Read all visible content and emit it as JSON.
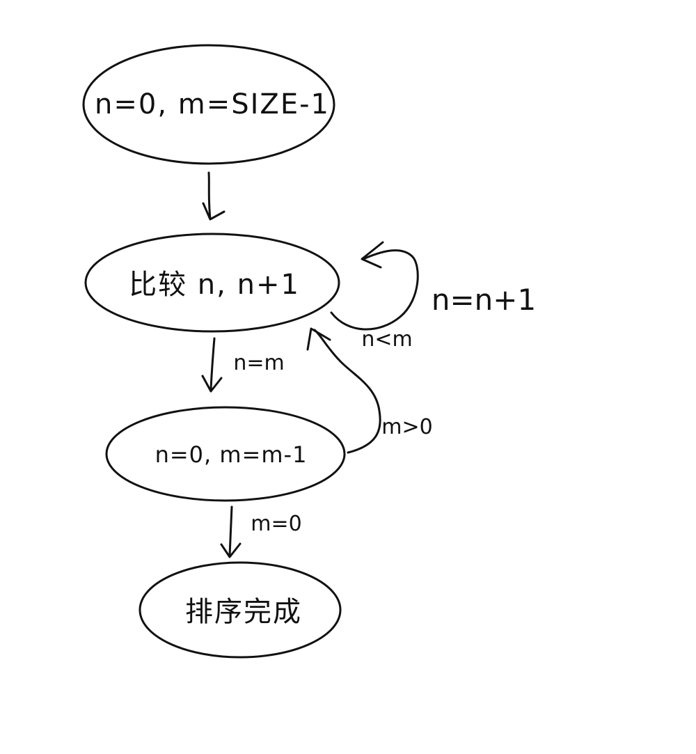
{
  "diagram": {
    "nodes": [
      {
        "id": "init",
        "label": "n=0, m=SIZE-1"
      },
      {
        "id": "compare",
        "label": "比较 n, n+1"
      },
      {
        "id": "reset",
        "label": "n=0,  m=m-1"
      },
      {
        "id": "done",
        "label": "排序完成"
      }
    ],
    "edges": [
      {
        "id": "init-to-compare",
        "label": ""
      },
      {
        "id": "compare-loop",
        "label": "n<m"
      },
      {
        "id": "compare-to-reset",
        "label": "n=m"
      },
      {
        "id": "reset-to-compare",
        "label": "m>0"
      },
      {
        "id": "reset-to-done",
        "label": "m=0"
      }
    ],
    "loop_annotation": "n=n+1"
  },
  "colors": {
    "ink": "#111111",
    "background": "#ffffff"
  }
}
